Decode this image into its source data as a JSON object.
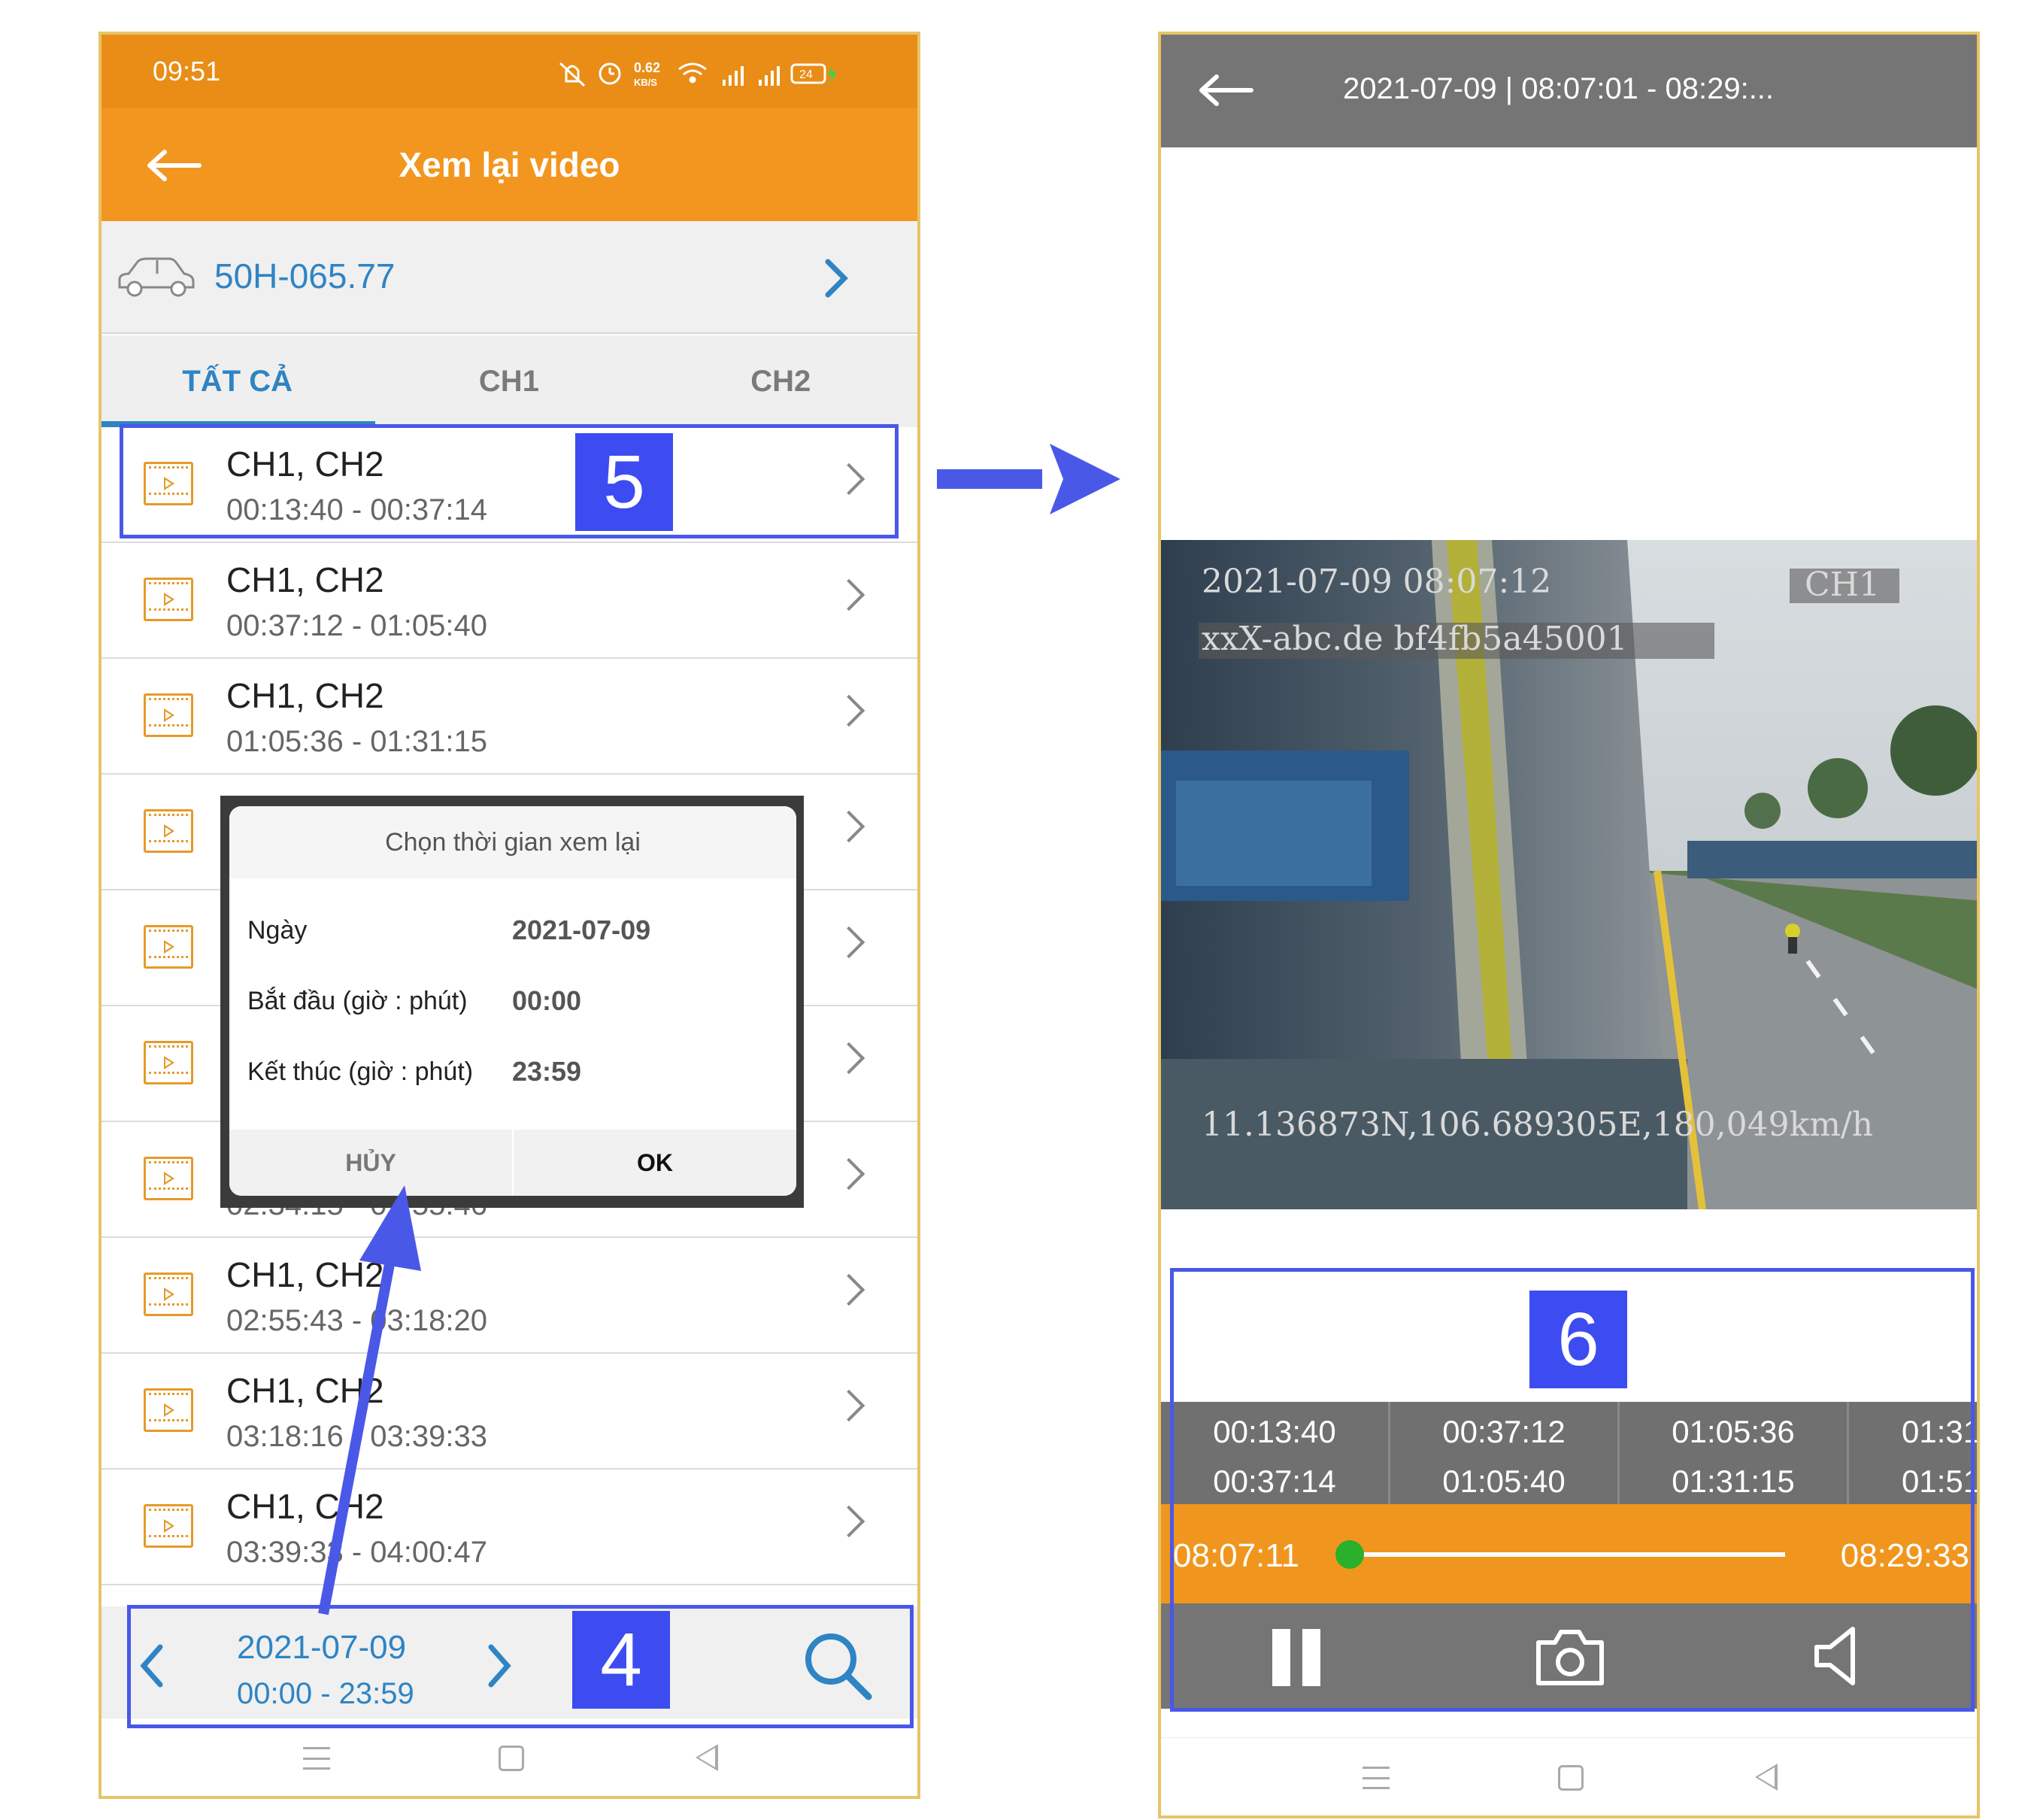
{
  "left": {
    "status": {
      "time": "09:51",
      "speed_top": "0.62",
      "speed_bottom": "KB/S",
      "battery": "24"
    },
    "appbar": {
      "title": "Xem lại video"
    },
    "vehicle": {
      "plate": "50H-065.77",
      "car_icon": "car-icon"
    },
    "tabs": [
      {
        "label": "TẤT CẢ"
      },
      {
        "label": "CH1"
      },
      {
        "label": "CH2"
      }
    ],
    "rows": [
      {
        "ch": "CH1, CH2",
        "time": "00:13:40 - 00:37:14"
      },
      {
        "ch": "CH1, CH2",
        "time": "00:37:12 - 01:05:40"
      },
      {
        "ch": "CH1, CH2",
        "time": "01:05:36 - 01:31:15"
      },
      {
        "ch": "",
        "time": ""
      },
      {
        "ch": "",
        "time": ""
      },
      {
        "ch": "",
        "time": ""
      },
      {
        "ch": "",
        "time": "02:34:15 - 02:55:46"
      },
      {
        "ch": "CH1, CH2",
        "time": "02:55:43 - 03:18:20"
      },
      {
        "ch": "CH1, CH2",
        "time": "03:18:16 - 03:39:33"
      },
      {
        "ch": "CH1, CH2",
        "time": "03:39:33 - 04:00:47"
      }
    ],
    "dialog": {
      "title": "Chọn thời gian xem lại",
      "date_label": "Ngày",
      "date_value": "2021-07-09",
      "start_label": "Bắt đầu (giờ : phút)",
      "start_value": "00:00",
      "end_label": "Kết thúc (giờ : phút)",
      "end_value": "23:59",
      "cancel": "HỦY",
      "ok": "OK"
    },
    "bottom": {
      "date": "2021-07-09",
      "range": "00:00 - 23:59"
    },
    "badges": {
      "five": "5",
      "four": "4"
    }
  },
  "right": {
    "title": "2021-07-09 | 08:07:01 - 08:29:...",
    "video_overlay": {
      "timestamp": "2021-07-09 08:07:12",
      "channel": "CH1",
      "id": "xxX-abc.de bf4fb5a45001",
      "gps": "11.136873N,106.689305E,180,049km/h"
    },
    "segments": [
      {
        "start": "00:13:40",
        "end": "00:37:14"
      },
      {
        "start": "00:37:12",
        "end": "01:05:40"
      },
      {
        "start": "01:05:36",
        "end": "01:31:15"
      },
      {
        "start": "01:31",
        "end": "01:51"
      }
    ],
    "seek": {
      "start": "08:07:11",
      "end": "08:29:33",
      "progress": 0
    },
    "badge_six": "6"
  },
  "colors": {
    "orange": "#f2961f",
    "blue": "#2f84c4",
    "annotation": "#4a58e8",
    "grey_bar": "#757575"
  }
}
